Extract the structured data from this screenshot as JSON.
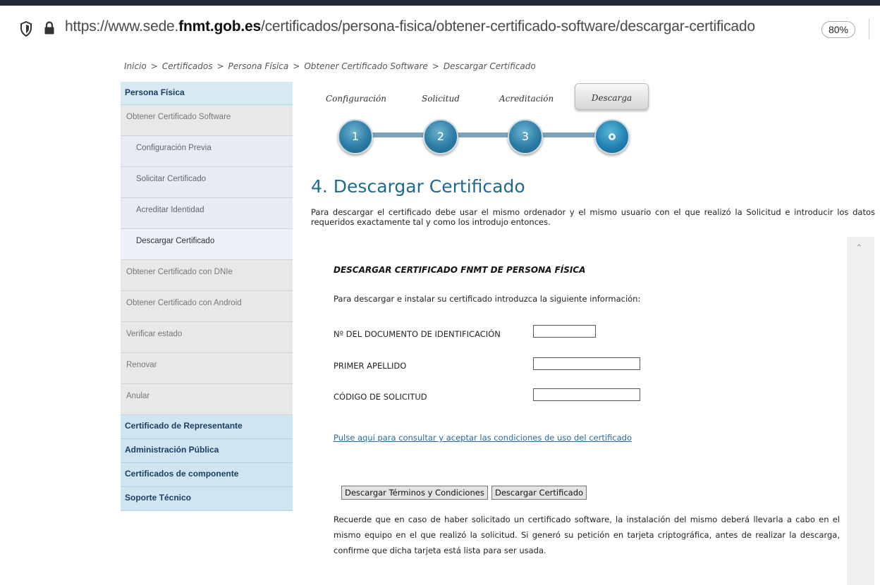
{
  "browser": {
    "url_prefix": "https://www.sede.",
    "url_domain": "fnmt.gob.es",
    "url_path": "/certificados/persona-fisica/obtener-certificado-software/descargar-certificado",
    "zoom": "80%"
  },
  "breadcrumb": [
    "Inicio",
    "Certificados",
    "Persona Física",
    "Obtener Certificado Software",
    "Descargar Certificado"
  ],
  "breadcrumb_sep": ">",
  "sidebar": {
    "header": "Persona Física",
    "items": [
      {
        "label": "Obtener Certificado Software",
        "kind": "item"
      },
      {
        "label": "Configuración Previa",
        "kind": "sub"
      },
      {
        "label": "Solicitar Certificado",
        "kind": "sub"
      },
      {
        "label": "Acreditar Identidad",
        "kind": "sub"
      },
      {
        "label": "Descargar Certificado",
        "kind": "sub-active"
      },
      {
        "label": "Obtener Certificado con DNIe",
        "kind": "item"
      },
      {
        "label": "Obtener Certificado con Android",
        "kind": "item"
      },
      {
        "label": "Verificar estado",
        "kind": "item"
      },
      {
        "label": "Renovar",
        "kind": "item"
      },
      {
        "label": "Anular",
        "kind": "item"
      }
    ],
    "categories": [
      "Certificado de Representante",
      "Administración Pública",
      "Certificados de componente",
      "Soporte Técnico"
    ]
  },
  "steps": {
    "labels": [
      "Configuración",
      "Solicitud",
      "Acreditación",
      "Descarga"
    ],
    "numbers": [
      "1",
      "2",
      "3"
    ]
  },
  "main": {
    "title": "4. Descargar Certificado",
    "intro": "Para descargar el certificado debe usar el mismo ordenador y el mismo usuario con el que realizó la Solicitud e introducir los datos requeridos exactamente tal y como los introdujo entonces."
  },
  "form": {
    "title": "DESCARGAR CERTIFICADO FNMT DE PERSONA FÍSICA",
    "subtitle": "Para descargar e instalar su certificado introduzca la siguiente información:",
    "doc_label": "Nº DEL DOCUMENTO DE IDENTIFICACIÓN",
    "surname_label": "PRIMER APELLIDO",
    "code_label": "CÓDIGO DE SOLICITUD",
    "doc_value": "",
    "surname_value": "",
    "code_value": "",
    "conditions_link": "Pulse aquí para consultar y aceptar las condiciones de uso del certificado",
    "terms_button": "Descargar Términos y Condiciones",
    "download_button": "Descargar Certificado",
    "note": "Recuerde que en caso de haber solicitado un certificado software, la instalación del mismo deberá llevarla a cabo en el mismo equipo en el que realizó la solicitud. Si generó su petición en tarjeta criptográfica, antes de realizar la descarga, confirme que dicha tarjeta está lista para ser usada."
  }
}
